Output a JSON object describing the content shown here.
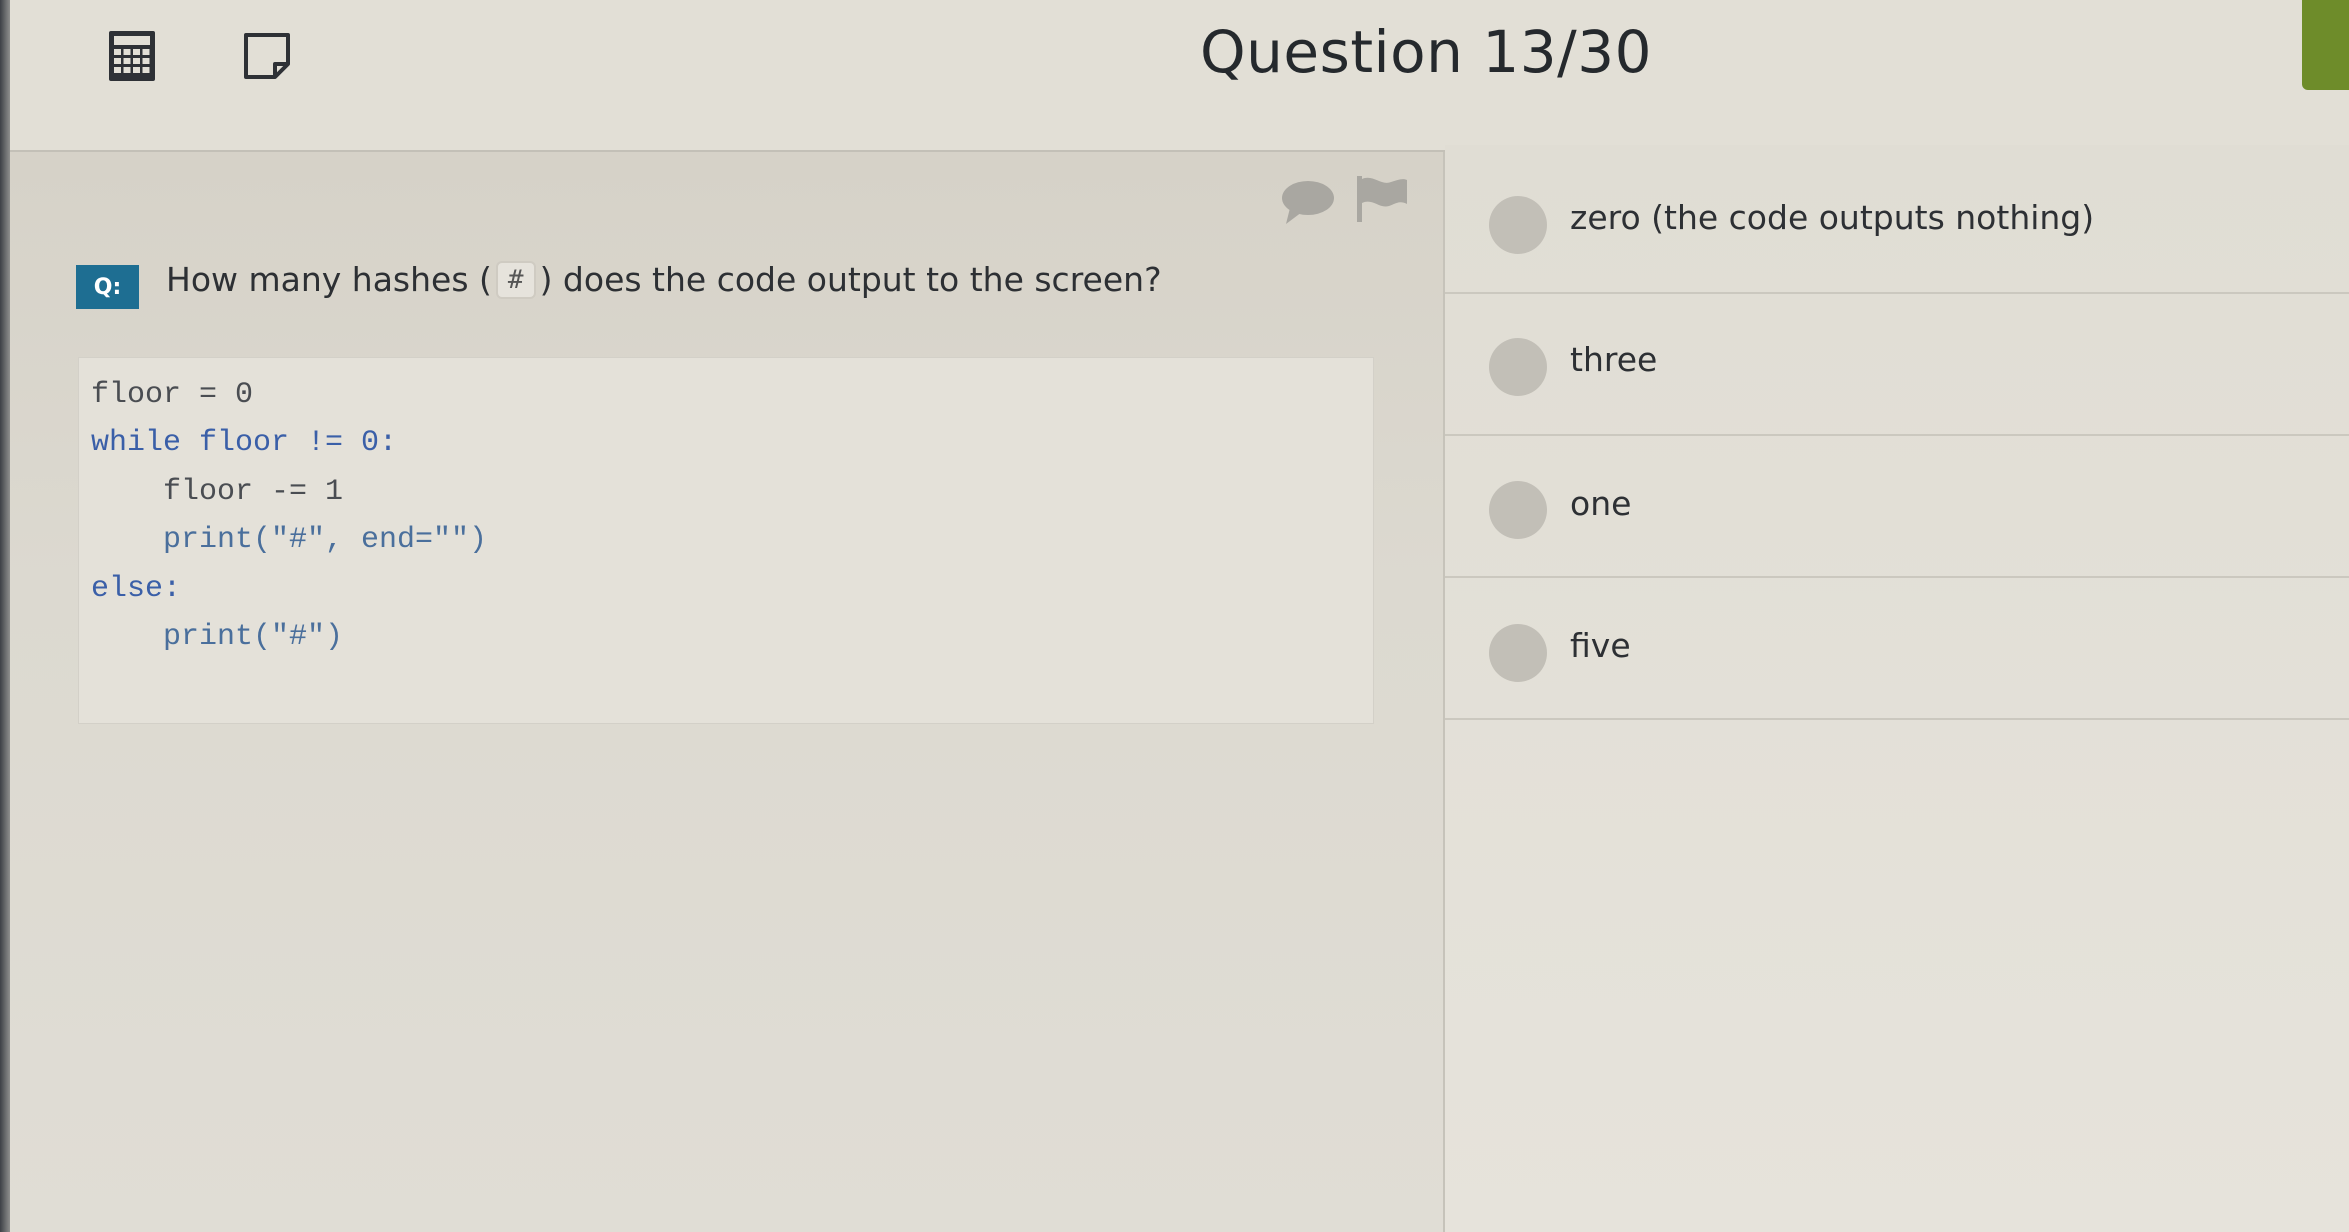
{
  "header": {
    "question_counter": "Question 13/30",
    "icons": [
      "calculator-icon",
      "note-icon"
    ]
  },
  "question": {
    "badge": "Q:",
    "text_before": "How many hashes (",
    "hash_symbol": "#",
    "text_after": ") does the code output to the screen?"
  },
  "code": {
    "lines": [
      "floor = 0",
      "while floor != 0:",
      "    floor -= 1",
      "    print(\"#\", end=\"\")",
      "else:",
      "    print(\"#\")"
    ]
  },
  "options": [
    {
      "label": "zero (the code outputs nothing)"
    },
    {
      "label": "three"
    },
    {
      "label": "one"
    },
    {
      "label": "five"
    }
  ],
  "colors": {
    "badge": "#1e6e92",
    "keyword": "#3a5fa8",
    "accent_green": "#6e8c2a",
    "radio": "#c2bfb7"
  }
}
